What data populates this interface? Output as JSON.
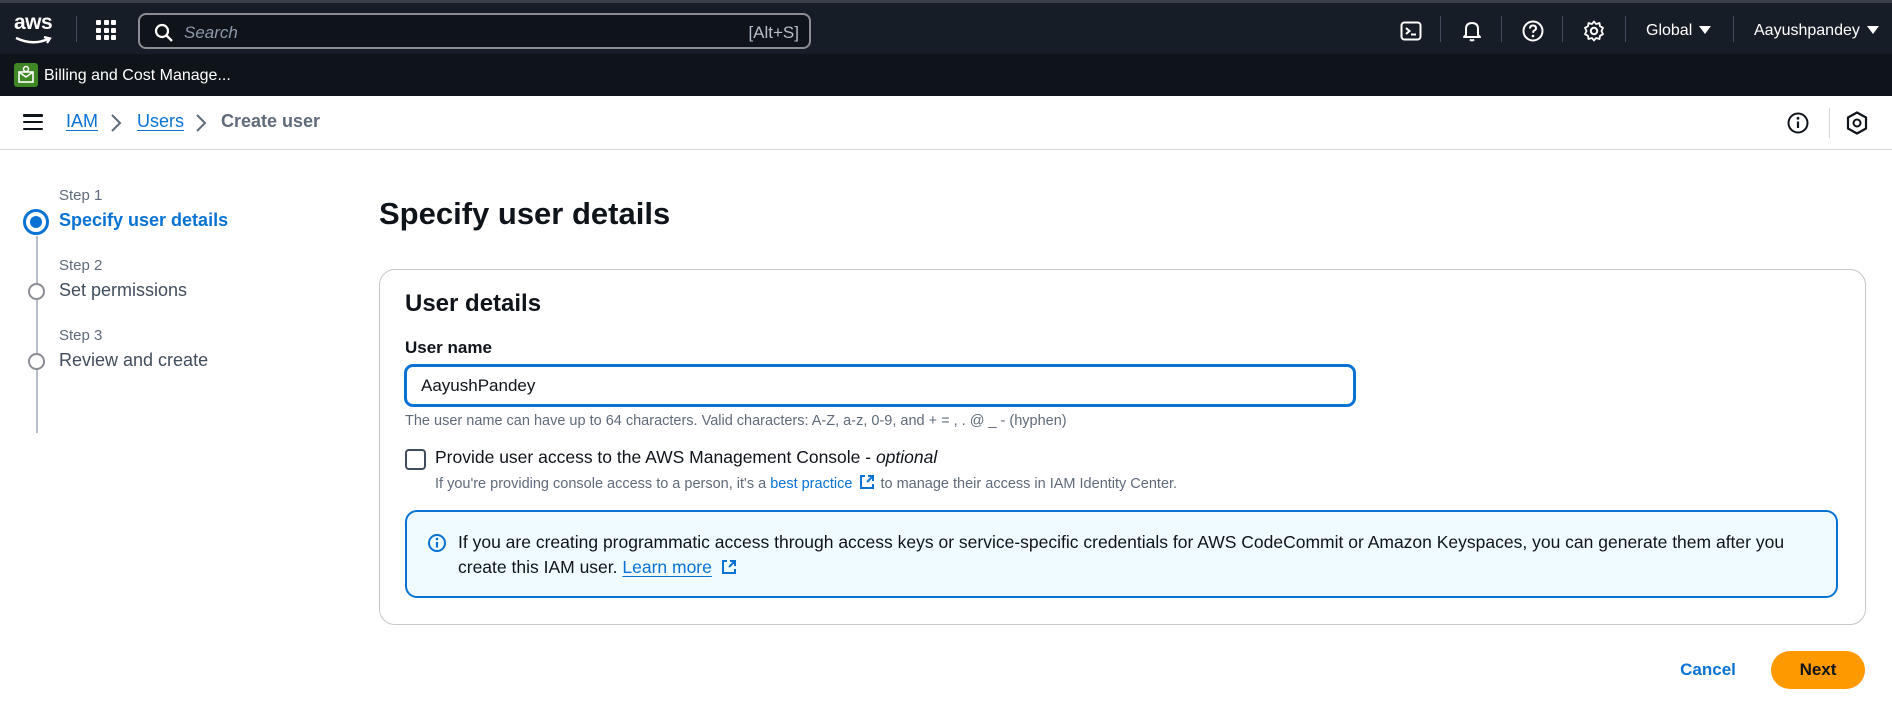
{
  "topbar": {
    "logo_text": "aws",
    "search_placeholder": "Search",
    "search_shortcut": "[Alt+S]",
    "region": "Global",
    "account": "Aayushpandey"
  },
  "servicebar": {
    "service_label": "Billing and Cost Manage..."
  },
  "breadcrumb": {
    "items": [
      "IAM",
      "Users",
      "Create user"
    ]
  },
  "steps": [
    {
      "number": "Step 1",
      "title": "Specify user details",
      "active": true
    },
    {
      "number": "Step 2",
      "title": "Set permissions",
      "active": false
    },
    {
      "number": "Step 3",
      "title": "Review and create",
      "active": false
    }
  ],
  "main": {
    "page_title": "Specify user details",
    "container_title": "User details",
    "user_name_label": "User name",
    "user_name_value": "AayushPandey",
    "user_name_constraint": "The user name can have up to 64 characters. Valid characters: A-Z, a-z, 0-9, and + = , . @ _ - (hyphen)",
    "console_access_label": "Provide user access to the AWS Management Console - ",
    "console_access_optional": "optional",
    "console_access_desc_prefix": "If you're providing console access to a person, it's a ",
    "console_access_desc_link": "best practice",
    "console_access_desc_suffix": " to manage their access in IAM Identity Center.",
    "console_access_checked": false,
    "info_text": "If you are creating programmatic access through access keys or service-specific credentials for AWS CodeCommit or Amazon Keyspaces, you can generate them after you create this IAM user. ",
    "info_link": "Learn more"
  },
  "actions": {
    "cancel": "Cancel",
    "next": "Next"
  },
  "colors": {
    "topbar_bg": "#161d26",
    "link": "#0972d3",
    "primary_button": "#ff9900",
    "info_bg": "#f0fbff"
  }
}
